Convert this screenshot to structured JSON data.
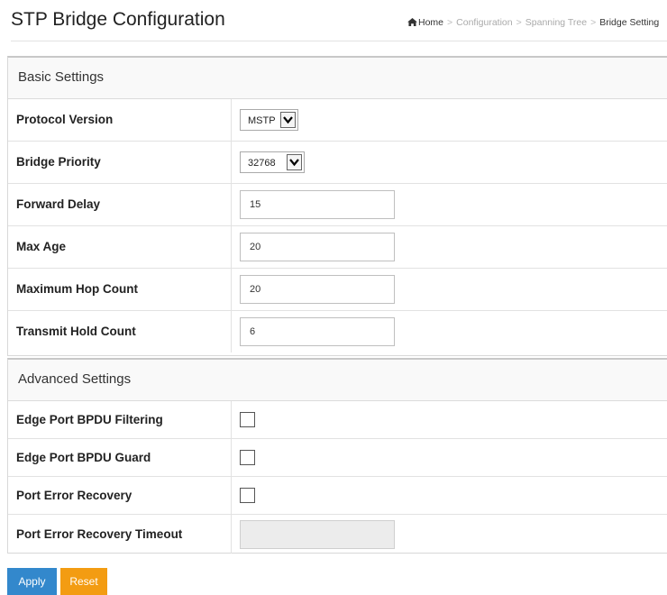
{
  "header": {
    "title": "STP Bridge Configuration",
    "breadcrumb": {
      "home": "Home",
      "items": [
        "Configuration",
        "Spanning Tree"
      ],
      "current": "Bridge Setting",
      "separator": ">"
    }
  },
  "basic": {
    "title": "Basic Settings",
    "protocol_version": {
      "label": "Protocol Version",
      "value": "MSTP"
    },
    "bridge_priority": {
      "label": "Bridge Priority",
      "value": "32768"
    },
    "forward_delay": {
      "label": "Forward Delay",
      "value": "15"
    },
    "max_age": {
      "label": "Max Age",
      "value": "20"
    },
    "max_hop_count": {
      "label": "Maximum Hop Count",
      "value": "20"
    },
    "transmit_hold_count": {
      "label": "Transmit Hold Count",
      "value": "6"
    }
  },
  "advanced": {
    "title": "Advanced Settings",
    "bpdu_filtering": {
      "label": "Edge Port BPDU Filtering",
      "checked": false
    },
    "bpdu_guard": {
      "label": "Edge Port BPDU Guard",
      "checked": false
    },
    "error_recovery": {
      "label": "Port Error Recovery",
      "checked": false
    },
    "error_recovery_timeout": {
      "label": "Port Error Recovery Timeout",
      "value": "",
      "disabled": true
    }
  },
  "buttons": {
    "apply": "Apply",
    "reset": "Reset"
  },
  "colors": {
    "apply": "#3388cc",
    "reset": "#f39c12"
  },
  "icons": {
    "home": "home-icon",
    "dropdown": "chevron-down-icon"
  }
}
